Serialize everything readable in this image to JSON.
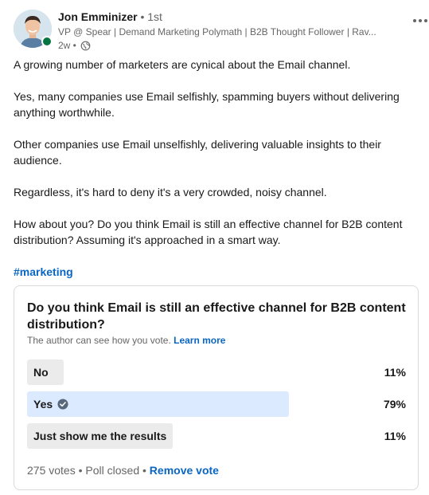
{
  "author": {
    "name": "Jon Emminizer",
    "degree": "• 1st",
    "headline": "VP @ Spear | Demand Marketing Polymath | B2B Thought Follower | Rav...",
    "time": "2w •",
    "visibility_icon": "globe-icon",
    "presence_color": "#057642"
  },
  "post": {
    "paragraphs": [
      "A growing number of marketers are cynical about the Email channel.",
      "Yes, many companies use Email selfishly, spamming buyers without delivering anything worthwhile.",
      "Other companies use Email unselfishly, delivering valuable insights to their audience.",
      "Regardless, it's hard to deny it's a very crowded, noisy channel.",
      "How about you? Do you think Email is still an effective channel for B2B content distribution? Assuming it's approached in a smart way."
    ],
    "hashtag": "#marketing"
  },
  "poll": {
    "question": "Do you think Email is still an effective channel for B2B content distribution?",
    "note": "The author can see how you vote.",
    "learn_more": "Learn more",
    "options": [
      {
        "label": "No",
        "percent": "11%",
        "fraction": 0.11,
        "selected": false
      },
      {
        "label": "Yes",
        "percent": "79%",
        "fraction": 0.79,
        "selected": true
      },
      {
        "label": "Just show me the results",
        "percent": "11%",
        "fraction": 0.11,
        "selected": false
      }
    ],
    "votes": "275 votes",
    "status": "Poll closed",
    "remove_vote": "Remove vote"
  },
  "colors": {
    "link": "#0a66c2",
    "selected_bar": "#dbeafe",
    "bar": "#ebebeb"
  }
}
